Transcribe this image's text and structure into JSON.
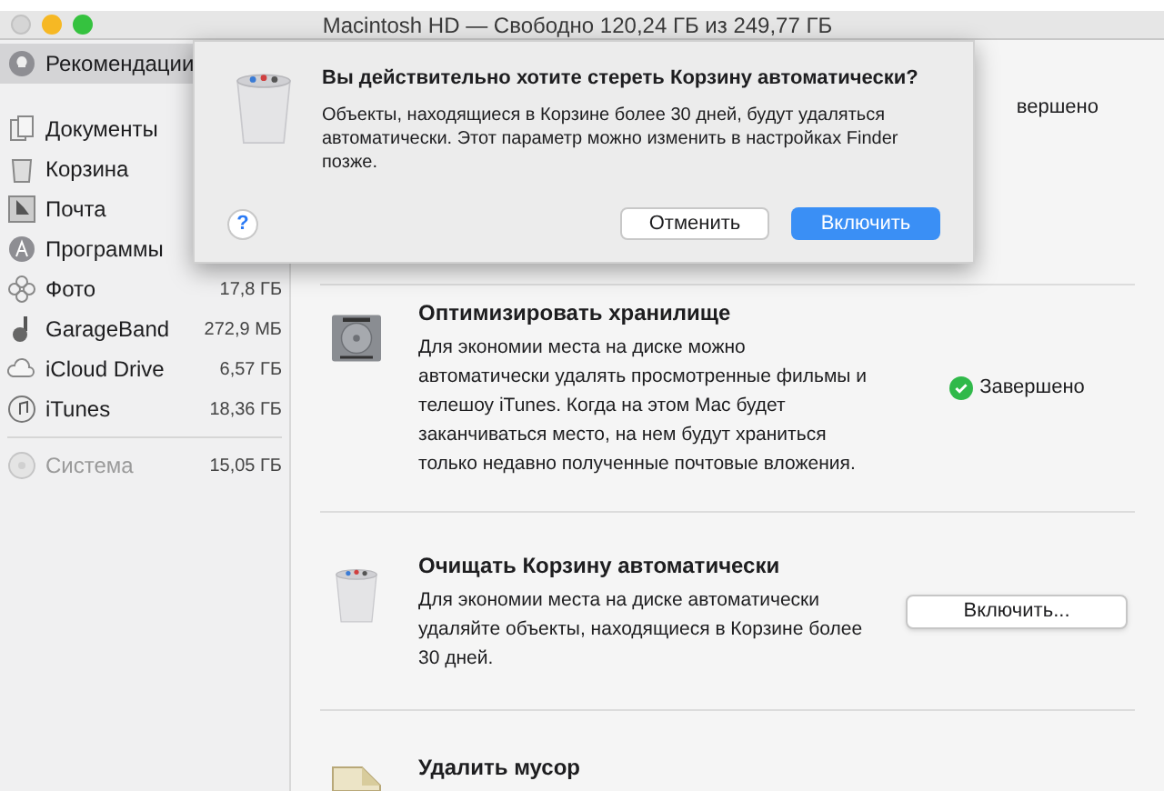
{
  "window": {
    "title": "Macintosh HD — Свободно 120,24 ГБ из 249,77 ГБ"
  },
  "sidebar": {
    "items": [
      {
        "label": "Рекомендации",
        "selected": true,
        "disabled": false
      },
      {
        "label": "Документы",
        "selected": false,
        "disabled": false
      },
      {
        "label": "Корзина",
        "selected": false,
        "disabled": false
      },
      {
        "label": "Почта",
        "selected": false,
        "disabled": false
      },
      {
        "label": "Программы",
        "selected": false,
        "disabled": false
      },
      {
        "label": "Фото",
        "size": "17,8 ГБ",
        "selected": false,
        "disabled": false
      },
      {
        "label": "GarageBand",
        "size": "272,9 МБ",
        "selected": false,
        "disabled": false
      },
      {
        "label": "iCloud Drive",
        "size": "6,57 ГБ",
        "selected": false,
        "disabled": false
      },
      {
        "label": "iTunes",
        "size": "18,36 ГБ",
        "selected": false,
        "disabled": false
      },
      {
        "label": "Система",
        "size": "15,05 ГБ",
        "selected": false,
        "disabled": true
      }
    ]
  },
  "sections": [
    {
      "kind": "status",
      "status": "вершено"
    },
    {
      "kind": "status",
      "title": "Оптимизировать хранилище",
      "description": "Для экономии места на диске можно автоматически удалять просмотренные фильмы и телешоу iTunes. Когда на этом Mac будет заканчиваться место, на нем будут храниться только недавно полученные почтовые вложения.",
      "status": "Завершено"
    },
    {
      "kind": "button",
      "title": "Очищать Корзину автоматически",
      "description": "Для экономии места на диске автоматически удаляйте объекты, находящиеся в Корзине более 30 дней.",
      "button": "Включить..."
    },
    {
      "kind": "partial",
      "title": "Удалить мусор"
    }
  ],
  "dialog": {
    "title": "Вы действительно хотите стереть Корзину автоматически?",
    "message": "Объекты, находящиеся в Корзине более 30 дней, будут удаляться автоматически. Этот параметр можно изменить в настройках Finder позже.",
    "help": "?",
    "cancel": "Отменить",
    "confirm": "Включить"
  }
}
